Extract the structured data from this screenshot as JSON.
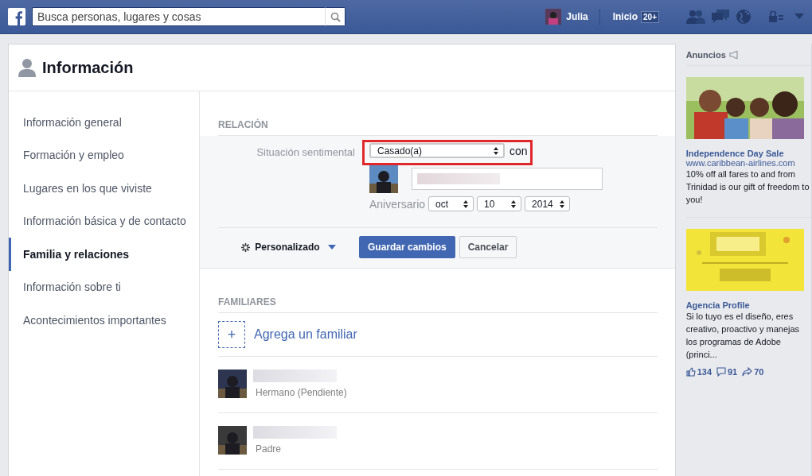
{
  "top_bar": {
    "search": {
      "placeholder": "Busca personas, lugares y cosas"
    },
    "user_name": "Julia",
    "home_label": "Inicio",
    "home_count": "20+"
  },
  "header": {
    "title": "Información"
  },
  "sidebar": {
    "items": [
      {
        "label": "Información general",
        "selected": false
      },
      {
        "label": "Formación y empleo",
        "selected": false
      },
      {
        "label": "Lugares en los que viviste",
        "selected": false
      },
      {
        "label": "Información básica y de contacto",
        "selected": false
      },
      {
        "label": "Familia y relaciones",
        "selected": true
      },
      {
        "label": "Información sobre ti",
        "selected": false
      },
      {
        "label": "Acontecimientos importantes",
        "selected": false
      }
    ]
  },
  "relationship": {
    "heading": "RELACIÓN",
    "status_label": "Situación sentimental",
    "status_value": "Casado(a)",
    "with_label": "con",
    "anniversary_label": "Aniversario",
    "month": "oct",
    "day": "10",
    "year": "2014",
    "privacy": "Personalizado",
    "save": "Guardar cambios",
    "cancel": "Cancelar"
  },
  "family": {
    "heading": "FAMILIARES",
    "add_label": "Agrega un familiar",
    "add_icon": "+",
    "members": [
      {
        "relation": "Hermano (Pendiente)"
      },
      {
        "relation": "Padre"
      }
    ]
  },
  "ads": {
    "heading": "Anuncios",
    "items": [
      {
        "kind": "picture",
        "title": "Independence Day Sale",
        "url": "www.caribbean-airlines.com",
        "text": "10% off all fares to and from Trinidad is our gift of freedom to you!"
      },
      {
        "kind": "picture",
        "title": "Agencia Profile",
        "text": "Si lo tuyo es el diseño, eres creativo, proactivo y manejas los programas de Adobe (princi...",
        "likes": "134",
        "comments": "91",
        "shares": "70"
      }
    ]
  }
}
